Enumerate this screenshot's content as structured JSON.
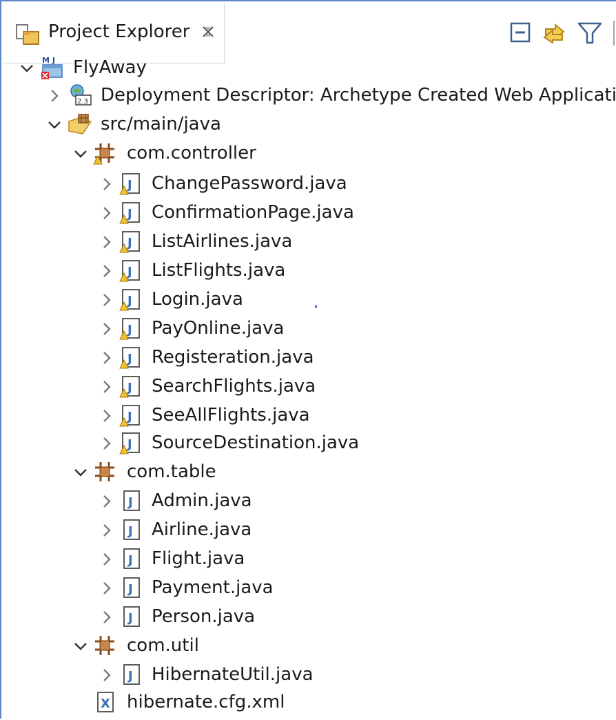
{
  "view": {
    "title": "Project Explorer",
    "close_icon": "close-x-icon",
    "toolbar": [
      "collapse-all-icon",
      "link-with-editor-icon",
      "filter-icon"
    ]
  },
  "tree": {
    "project": {
      "label": "FlyAway",
      "icon": "maven-web-project-icon",
      "expanded": true
    },
    "deployment": {
      "label": "Deployment Descriptor: Archetype Created Web Application",
      "icon": "deployment-descriptor-icon",
      "expanded": false
    },
    "src_folder": {
      "label": "src/main/java",
      "icon": "source-folder-icon",
      "expanded": true
    },
    "packages": [
      {
        "label": "com.controller",
        "warning": true,
        "files": [
          "ChangePassword.java",
          "ConfirmationPage.java",
          "ListAirlines.java",
          "ListFlights.java",
          "Login.java",
          "PayOnline.java",
          "Registeration.java",
          "SearchFlights.java",
          "SeeAllFlights.java",
          "SourceDestination.java"
        ]
      },
      {
        "label": "com.table",
        "warning": false,
        "files": [
          "Admin.java",
          "Airline.java",
          "Flight.java",
          "Payment.java",
          "Person.java"
        ]
      },
      {
        "label": "com.util",
        "warning": false,
        "files": [
          "HibernateUtil.java"
        ]
      }
    ],
    "xml_file": {
      "label": "hibernate.cfg.xml",
      "icon": "xml-file-icon"
    }
  },
  "colors": {
    "frame_border": "#5b86c5",
    "package": "#8a4b1a",
    "java_file": "#3b6fb6",
    "warning": "#e8b31e"
  }
}
